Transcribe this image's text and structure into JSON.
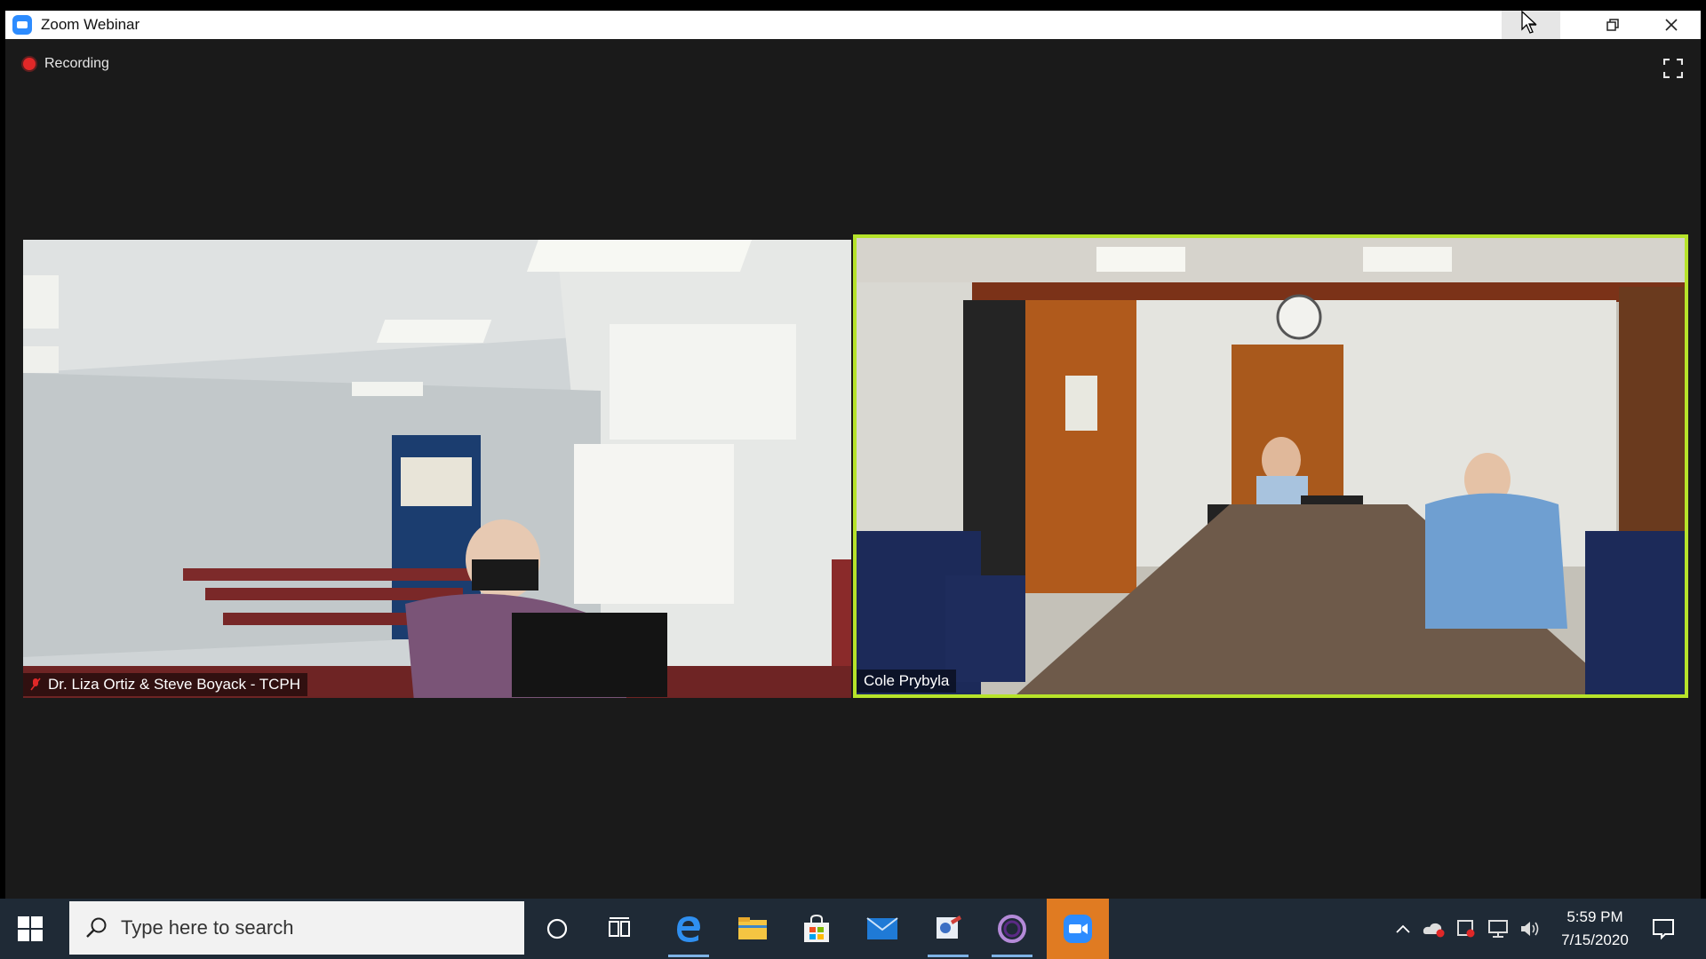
{
  "window": {
    "title": "Zoom Webinar",
    "controls": [
      "minimize",
      "restore",
      "close"
    ]
  },
  "recording": {
    "label": "Recording"
  },
  "video_tiles": [
    {
      "name": "Dr. Liza Ortiz & Steve Boyack - TCPH",
      "muted": true,
      "active_speaker": false
    },
    {
      "name": "Cole Prybyla",
      "muted": false,
      "active_speaker": true
    }
  ],
  "taskbar": {
    "search_placeholder": "Type here to search",
    "apps": [
      "cortana-icon",
      "task-view-icon",
      "edge-icon",
      "file-explorer-icon",
      "store-icon",
      "mail-icon",
      "paint-icon",
      "circle-app-icon",
      "zoom-icon"
    ],
    "time": "5:59 PM",
    "date": "7/15/2020"
  },
  "colors": {
    "active_speaker_border": "#b6e32a",
    "zoom_blue": "#2d8cff",
    "recording_red": "#e02828",
    "taskbar_bg": "#1f2a36"
  }
}
